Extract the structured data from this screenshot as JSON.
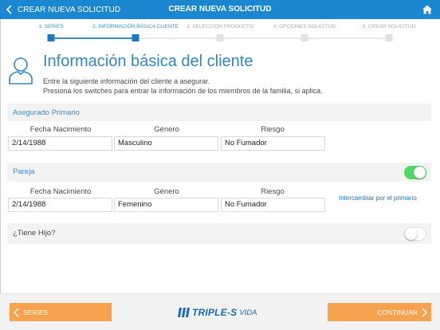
{
  "nav": {
    "back_label": "CREAR NUEVA SOLICITUD",
    "title": "CREAR NUEVA SOLICITUD"
  },
  "stepper": {
    "steps": [
      {
        "label": "1. SERIES",
        "state": "done"
      },
      {
        "label": "2. INFORMACIÓN BÁSICA CLIENTE",
        "state": "current"
      },
      {
        "label": "3. SELECCIÓN PRODUCTO",
        "state": "pending"
      },
      {
        "label": "4. OPCIONES SOLICITUD",
        "state": "pending"
      },
      {
        "label": "5. CREAR SOLICITUD",
        "state": "pending"
      }
    ]
  },
  "header": {
    "title": "Información básica del cliente",
    "desc_line1": "Entre la siguiente información del cliente a asegurar.",
    "desc_line2": "Presiona los switches para entrar la información de los miembros de la familia, si aplica."
  },
  "columns": {
    "birth": "Fecha Nacimiento",
    "gender": "Género",
    "risk": "Riesgo"
  },
  "primary": {
    "title": "Asegurado Primario",
    "birth": "2/14/1988",
    "gender": "Masculino",
    "risk": "No Fumador"
  },
  "spouse": {
    "title": "Pareja",
    "enabled": true,
    "birth": "2/14/1988",
    "gender": "Femenino",
    "risk": "No Fumador",
    "swap_label": "Intercambiar por el primario"
  },
  "child": {
    "label": "¿Tiene Hijo?",
    "enabled": false
  },
  "footer": {
    "back_label": "SERIES",
    "next_label": "CONTINUAR",
    "logo_text": "TRIPLE-S",
    "logo_sub": "VIDA"
  },
  "colors": {
    "nav": "#1c87d1",
    "accent": "#2f86c9",
    "button": "#f7a24e",
    "toggle_on": "#4cd964"
  }
}
